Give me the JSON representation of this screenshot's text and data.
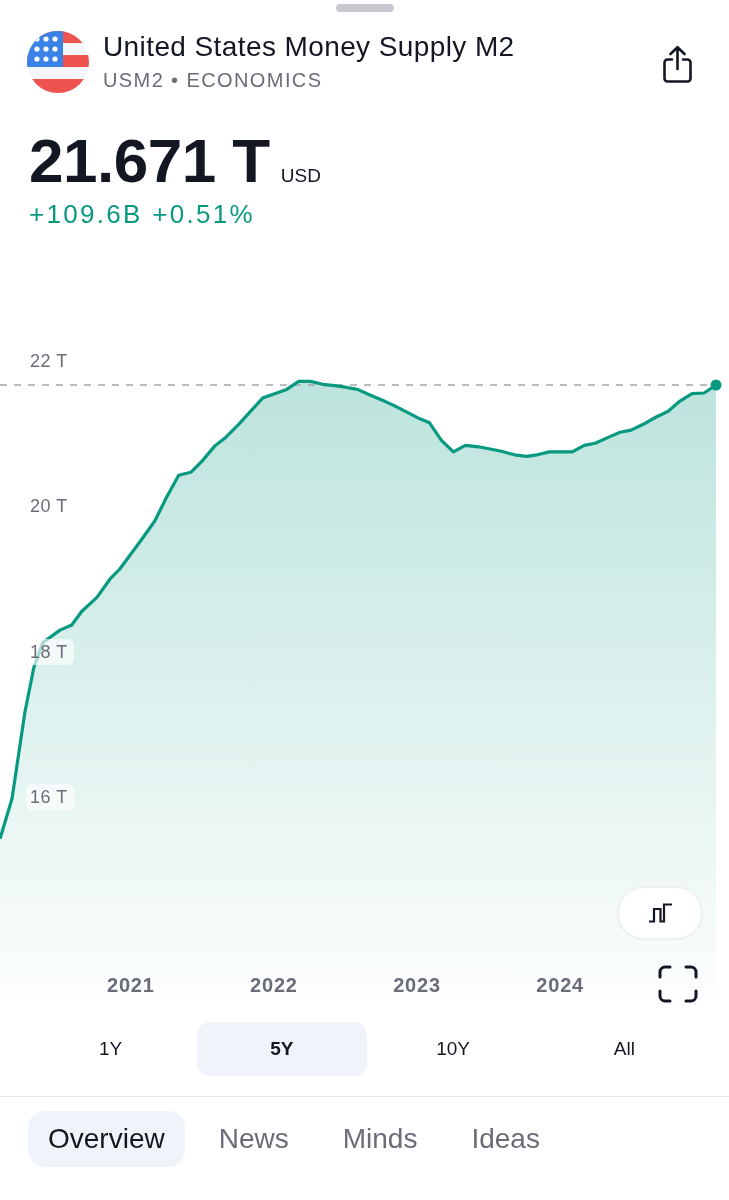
{
  "header": {
    "title": "United States Money Supply M2",
    "subtitle": "USM2 • ECONOMICS"
  },
  "price": {
    "value": "21.671 T",
    "currency": "USD",
    "change": "+109.6B",
    "change_percent": "+0.51%"
  },
  "chart": {
    "chart_data": {
      "type": "area",
      "x": [
        2020.086,
        2020.17,
        2020.26,
        2020.323,
        2020.386,
        2020.505,
        2020.588,
        2020.658,
        2020.763,
        2020.854,
        2020.923,
        2021.077,
        2021.168,
        2021.251,
        2021.335,
        2021.419,
        2021.496,
        2021.586,
        2021.663,
        2021.754,
        2021.838,
        2021.921,
        2022.005,
        2022.089,
        2022.173,
        2022.256,
        2022.34,
        2022.424,
        2022.5,
        2022.584,
        2022.675,
        2022.759,
        2022.836,
        2022.926,
        2023.003,
        2023.087,
        2023.17,
        2023.254,
        2023.338,
        2023.429,
        2023.512,
        2023.589,
        2023.68,
        2023.764,
        2023.84,
        2023.924,
        2024.008,
        2024.085,
        2024.168,
        2024.245,
        2024.336,
        2024.419,
        2024.496,
        2024.58,
        2024.671,
        2024.755,
        2024.831,
        2024.922,
        2025.006,
        2025.089
      ],
      "series": [
        {
          "color": "#089981",
          "values": [
            15.43,
            15.98,
            17.17,
            17.79,
            18.13,
            18.3,
            18.37,
            18.56,
            18.75,
            19.0,
            19.14,
            19.55,
            19.8,
            20.13,
            20.43,
            20.47,
            20.62,
            20.83,
            20.95,
            21.13,
            21.31,
            21.49,
            21.55,
            21.61,
            21.72,
            21.72,
            21.68,
            21.66,
            21.64,
            21.61,
            21.53,
            21.46,
            21.39,
            21.3,
            21.22,
            21.15,
            20.91,
            20.75,
            20.84,
            20.82,
            20.79,
            20.76,
            20.71,
            20.69,
            20.71,
            20.75,
            20.75,
            20.75,
            20.84,
            20.87,
            20.95,
            21.02,
            21.05,
            21.13,
            21.23,
            21.31,
            21.44,
            21.55,
            21.56,
            21.67
          ]
        }
      ],
      "xlim": [
        2020.086,
        2025.089
      ],
      "ylim": [
        13.09,
        23.54
      ],
      "xticks": [
        2021,
        2022,
        2023,
        2024
      ],
      "yticks": [
        {
          "value": 16,
          "label": "16 T"
        },
        {
          "value": 18,
          "label": "18 T"
        },
        {
          "value": 20,
          "label": "20 T"
        },
        {
          "value": 22,
          "label": "22 T"
        }
      ],
      "ref_lines": [
        {
          "axis": "y",
          "value": 21.67
        }
      ]
    }
  },
  "ranges": [
    {
      "label": "1Y",
      "selected": false
    },
    {
      "label": "5Y",
      "selected": true
    },
    {
      "label": "10Y",
      "selected": false
    },
    {
      "label": "All",
      "selected": false
    }
  ],
  "tabs": [
    {
      "label": "Overview",
      "selected": true
    },
    {
      "label": "News",
      "selected": false
    },
    {
      "label": "Minds",
      "selected": false
    },
    {
      "label": "Ideas",
      "selected": false
    }
  ]
}
